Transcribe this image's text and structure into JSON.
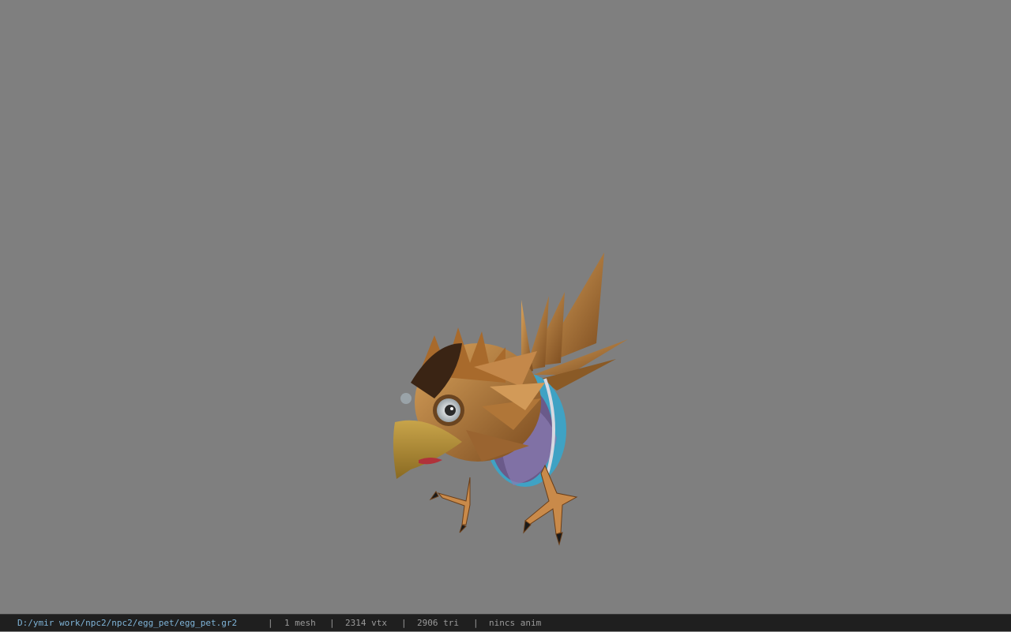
{
  "viewer": {
    "background_color": "#7f7f7f",
    "model_name": "egg-pet-bird-model"
  },
  "statusbar": {
    "file_path": "D:/ymir work/npc2/npc2/egg_pet/egg_pet.gr2",
    "separator": "|",
    "mesh": "1 mesh",
    "vtx": "2314 vtx",
    "tri": "2906 tri",
    "anim": "nincs anim"
  }
}
